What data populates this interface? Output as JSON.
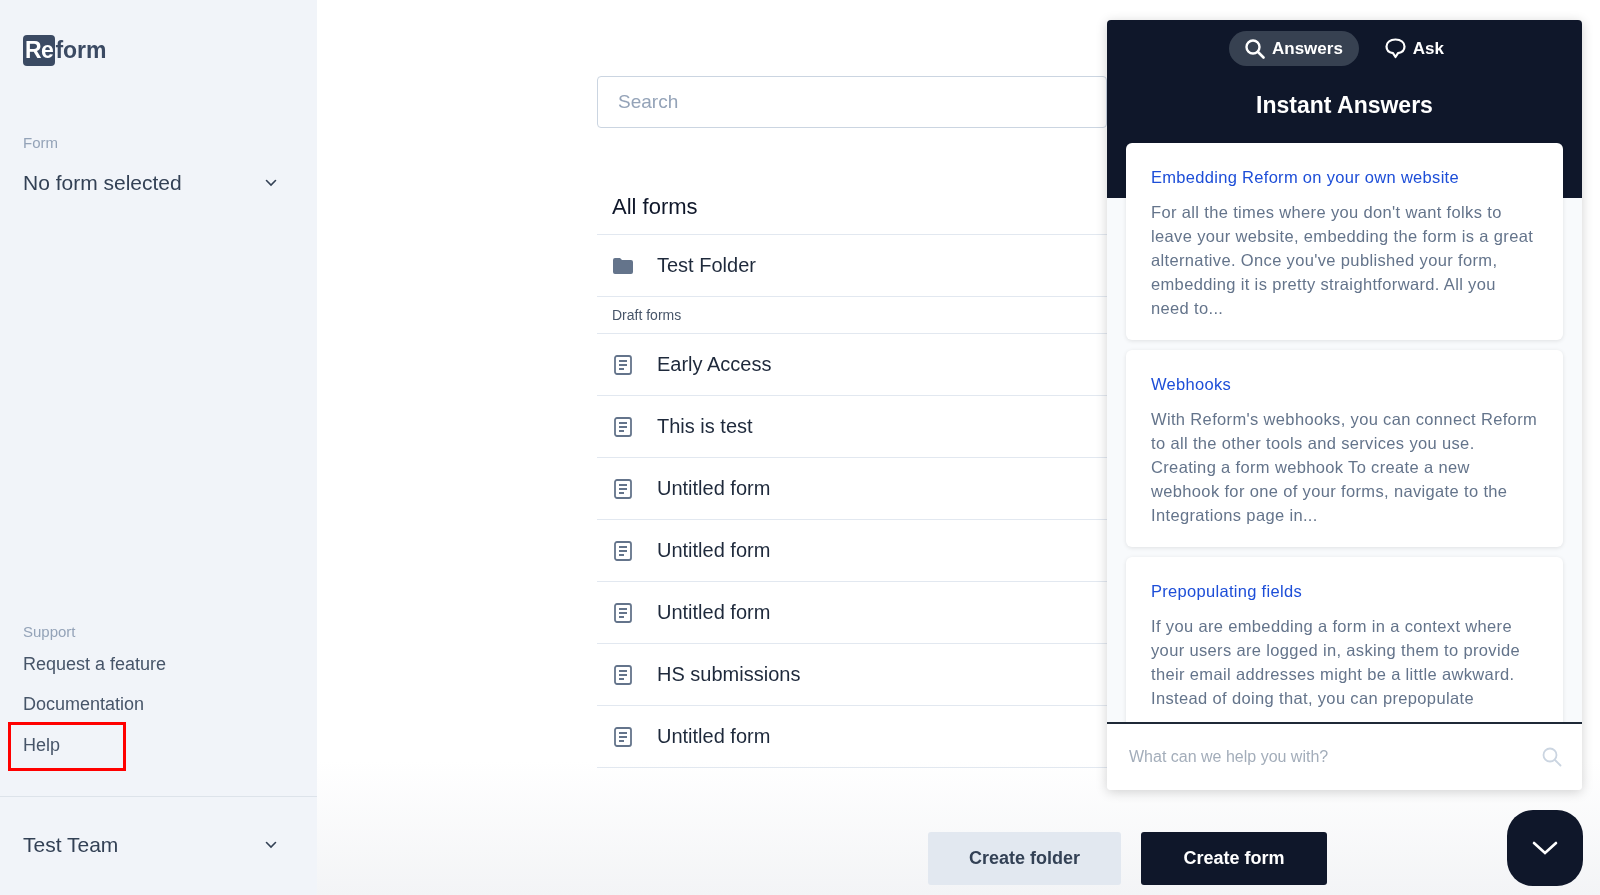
{
  "sidebar": {
    "logo": {
      "mark": "Re",
      "word": "form"
    },
    "form_label": "Form",
    "form_select": "No form selected",
    "support_label": "Support",
    "support_items": [
      {
        "label": "Request a feature",
        "highlighted": false
      },
      {
        "label": "Documentation",
        "highlighted": false
      },
      {
        "label": "Help",
        "highlighted": true
      }
    ],
    "team_select": "Test Team"
  },
  "search": {
    "placeholder": "Search"
  },
  "list": {
    "title": "All forms",
    "rows": [
      {
        "kind": "folder",
        "label": "Test Folder"
      },
      {
        "kind": "section",
        "label": "Draft forms"
      },
      {
        "kind": "form",
        "label": "Early Access"
      },
      {
        "kind": "form",
        "label": "This is test"
      },
      {
        "kind": "form",
        "label": "Untitled form"
      },
      {
        "kind": "form",
        "label": "Untitled form"
      },
      {
        "kind": "form",
        "label": "Untitled form"
      },
      {
        "kind": "form",
        "label": "HS submissions"
      },
      {
        "kind": "form",
        "label": "Untitled form"
      }
    ]
  },
  "buttons": [
    {
      "kind": "secondary",
      "label": "Create folder"
    },
    {
      "kind": "primary",
      "label": "Create form"
    }
  ],
  "help_panel": {
    "tabs": [
      {
        "label": "Answers",
        "selected": true
      },
      {
        "label": "Ask",
        "selected": false
      }
    ],
    "title": "Instant Answers",
    "articles": [
      {
        "title": "Embedding Reform on your own website",
        "summary": "For all the times where you don't want folks to leave your website, embedding the form is a great alternative. Once you've published your form, embedding it is pretty straightforward. All you need to..."
      },
      {
        "title": "Webhooks",
        "summary": "With Reform's webhooks, you can connect Reform to all the other tools and services you use. Creating a form webhook To create a new webhook for one of your forms, navigate to the Integrations page in..."
      },
      {
        "title": "Prepopulating fields",
        "summary": "If you are embedding a form in a context where your users are logged in, asking them to provide their email addresses might be a little awkward. Instead of doing that, you can prepopulate"
      }
    ],
    "query": {
      "placeholder": "What can we help you with?"
    }
  }
}
